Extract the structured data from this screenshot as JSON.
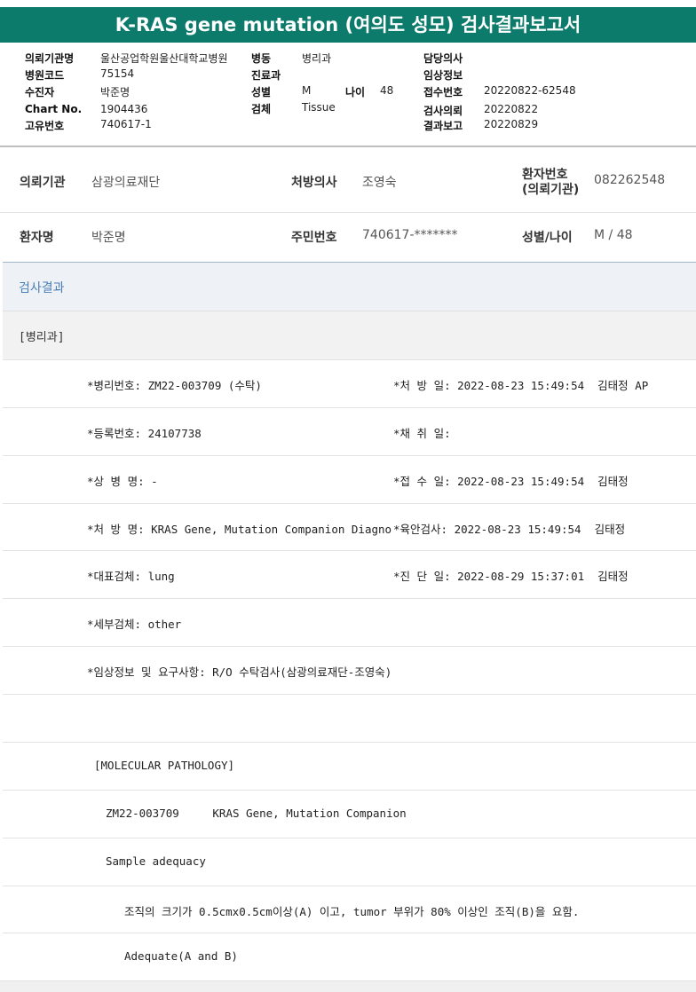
{
  "title": "K-RAS gene mutation (여의도 성모) 검사결과보고서",
  "header": {
    "col1": [
      {
        "label": "의뢰기관명",
        "value": "울산공업학원울산대학교병원"
      },
      {
        "label": "병원코드",
        "value": "75154"
      },
      {
        "label": "수진자",
        "value": "박준명"
      },
      {
        "label": "Chart No.",
        "value": "1904436"
      },
      {
        "label": "고유번호",
        "value": "740617-1"
      }
    ],
    "col2": [
      {
        "label": "병동",
        "value": "병리과"
      },
      {
        "label": "진료과",
        "value": ""
      },
      {
        "label": "성별",
        "value": "M"
      },
      {
        "label": "검체",
        "value": "Tissue"
      }
    ],
    "age_label": "나이",
    "age_value": "48",
    "col3": [
      {
        "label": "담당의사",
        "value": ""
      },
      {
        "label": "임상정보",
        "value": ""
      },
      {
        "label": "접수번호",
        "value": "20220822-62548"
      },
      {
        "label": "검사의뢰",
        "value": "20220822"
      },
      {
        "label": "결과보고",
        "value": "20220829"
      }
    ]
  },
  "info": {
    "row1": [
      {
        "label": "의뢰기관",
        "value": "삼광의료재단"
      },
      {
        "label": "처방의사",
        "value": "조영숙"
      },
      {
        "label": "환자번호 (의뢰기관)",
        "label_line1": "환자번호",
        "label_line2": "(의뢰기관)",
        "value": "082262548"
      }
    ],
    "row2": [
      {
        "label": "환자명",
        "value": "박준명"
      },
      {
        "label": "주민번호",
        "value": "740617-*******"
      },
      {
        "label": "성별/나이",
        "value": "M / 48"
      }
    ]
  },
  "results": {
    "section_title": "검사결과",
    "department": "[병리과]",
    "lines": [
      {
        "left": "*병리번호: ZM22-003709 (수탁)",
        "right": "*처 방 일: 2022-08-23 15:49:54  김태정 AP"
      },
      {
        "left": "*등록번호: 24107738",
        "right": "*채 취 일:"
      },
      {
        "left": "*상 병 명: -",
        "right": "*접 수 일: 2022-08-23 15:49:54  김태정"
      },
      {
        "left": "*처 방 명: KRAS Gene, Mutation Companion Diagno",
        "right": "*육안검사: 2022-08-23 15:49:54  김태정"
      },
      {
        "left": "*대표검체: lung",
        "right": "*진 단 일: 2022-08-29 15:37:01  김태정"
      },
      {
        "left": "*세부검체: other",
        "right": ""
      },
      {
        "left": "*임상정보 및 요구사항: R/O 수탁검사(삼광의료재단-조영숙)",
        "right": ""
      }
    ],
    "blank": "",
    "molecular_title": "[MOLECULAR PATHOLOGY]",
    "case_line": "ZM22-003709     KRAS Gene, Mutation Companion",
    "sample_label": "Sample adequacy",
    "criteria": "조직의 크기가 0.5cmx0.5cm이상(A) 이고, tumor 부위가 80% 이상인 조직(B)을 요함.",
    "adequacy": "Adequate(A and B)"
  }
}
